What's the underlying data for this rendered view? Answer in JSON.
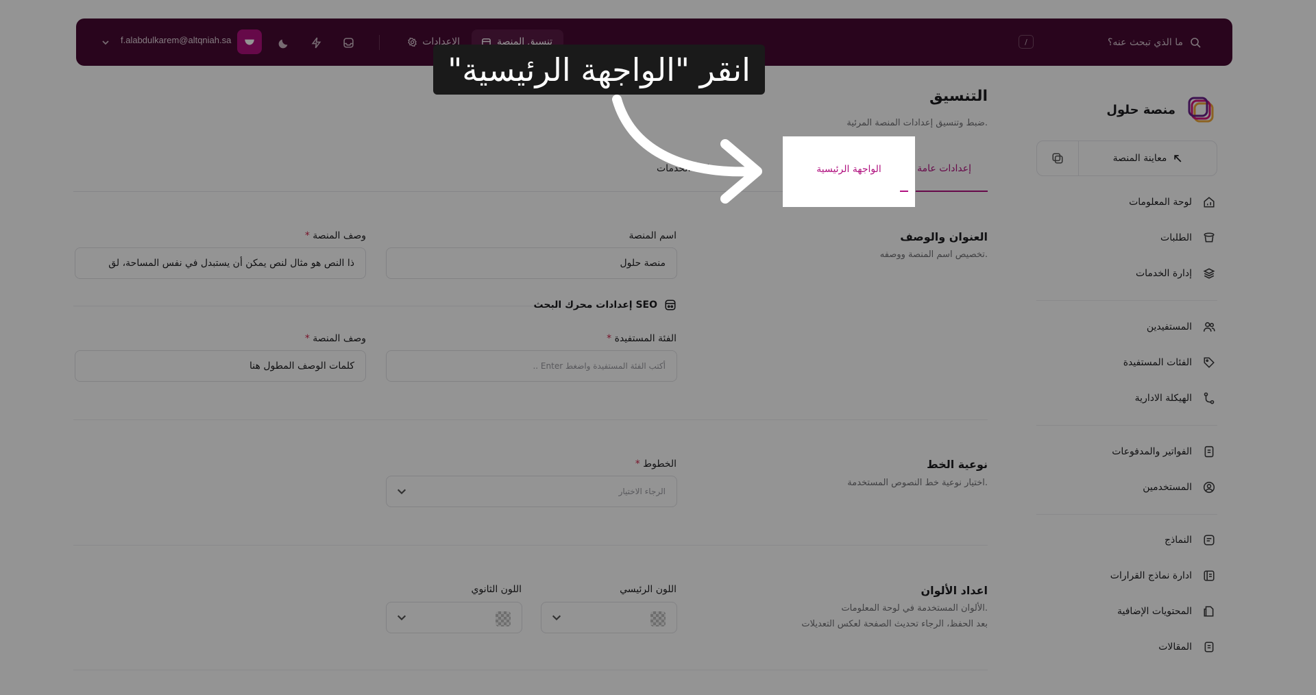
{
  "topbar": {
    "search_placeholder": "ما الذي تبحث عنه؟",
    "shortcut": "/",
    "tab_active": "تنسيق المنصة",
    "tab_settings": "الاعدادات",
    "email": "f.alabdulkarem@altqniah.sa"
  },
  "sidebar": {
    "title": "منصة حلول",
    "preview_label": "معاينة المنصة",
    "items": [
      {
        "label": "لوحة المعلومات",
        "icon": "chart-icon"
      },
      {
        "label": "الطلبات",
        "icon": "orders-icon"
      },
      {
        "label": "إدارة الخدمات",
        "icon": "services-icon"
      },
      {
        "label": "المستفيدين",
        "icon": "users-icon"
      },
      {
        "label": "الفئات المستفيدة",
        "icon": "tag-icon"
      },
      {
        "label": "الهيكلة الادارية",
        "icon": "structure-icon"
      },
      {
        "label": "الفواتير والمدفوعات",
        "icon": "invoice-icon"
      },
      {
        "label": "المستخدمين",
        "icon": "user-circle-icon"
      },
      {
        "label": "النماذج",
        "icon": "forms-icon"
      },
      {
        "label": "ادارة نماذج القرارات",
        "icon": "decision-icon"
      },
      {
        "label": "المحتويات الإضافية",
        "icon": "content-icon"
      },
      {
        "label": "المقالات",
        "icon": "articles-icon"
      }
    ]
  },
  "page": {
    "title": "التنسيق",
    "subtitle": "ضبط وتنسيق إعدادات المنصة المرئية.",
    "tabs": {
      "general": "إعدادات عامة",
      "home": "الواجهة الرئيسية",
      "other": "قائمة الخدمات"
    }
  },
  "sections": {
    "title_desc": {
      "title": "العنوان والوصف",
      "desc": "تخصيص اسم المنصة ووصفه.",
      "name_label": "اسم المنصة",
      "name_value": "منصة حلول",
      "desc_label": "وصف المنصة",
      "desc_value": "ذا النص هو مثال لنص يمكن أن يستبدل في نفس المساحة، لق",
      "seo_title": "إعدادات محرك البحث SEO",
      "audience_label": "الفئة المستفيدة",
      "audience_placeholder": "أكتب الفئة المستفيدة واضغط Enter ..",
      "seo_desc_label": "وصف المنصة",
      "seo_desc_value": "كلمات الوصف المطول هنا"
    },
    "font": {
      "title": "نوعية الخط",
      "desc": "اختيار نوعية خط النصوص المستخدمة.",
      "fonts_label": "الخطوط",
      "fonts_placeholder": "الرجاء الاختيار"
    },
    "colors": {
      "title": "اعداد الألوان",
      "desc1": "الألوان المستخدمة في لوحة المعلومات.",
      "desc2": "بعد الحفظ، الرجاء تحديث الصفحة لعكس التعديلات",
      "primary_label": "اللون الرئيسي",
      "secondary_label": "اللون الثانوي"
    }
  },
  "overlay": {
    "callout_text": "انقر \"الواجهة الرئيسية\"",
    "highlight_label": "الواجهة الرئيسية"
  },
  "colors": {
    "brand": "#b0117f",
    "topbar": "#470a33"
  }
}
